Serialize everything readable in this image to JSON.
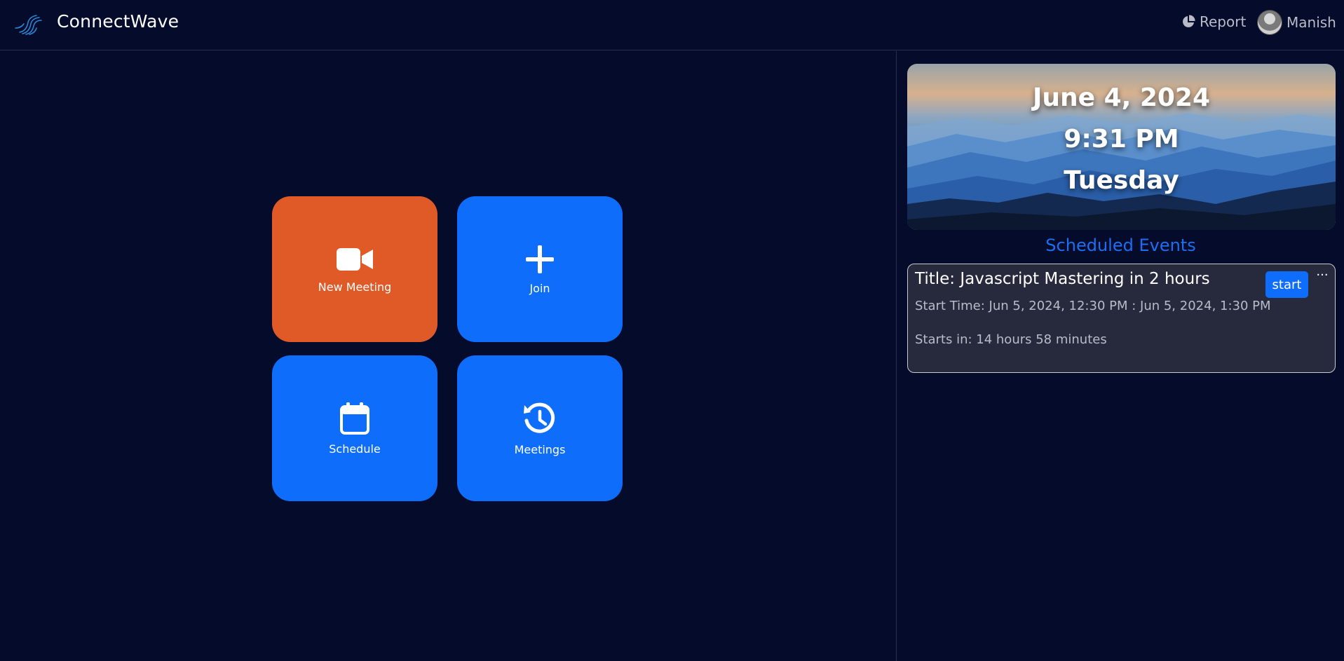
{
  "navbar": {
    "brand": "ConnectWave",
    "report_label": "Report",
    "user_name": "Manish"
  },
  "tiles": {
    "new_meeting": "New Meeting",
    "join": "Join",
    "schedule": "Schedule",
    "meetings": "Meetings"
  },
  "hero": {
    "date": "June 4, 2024",
    "time": "9:31 PM",
    "day": "Tuesday"
  },
  "scheduled": {
    "heading": "Scheduled Events",
    "events": [
      {
        "title": "Title: Javascript Mastering in 2 hours",
        "start_time": "Start Time: Jun 5, 2024, 12:30 PM : Jun 5, 2024, 1:30 PM",
        "starts_in": "Starts in: 14 hours 58 minutes",
        "start_label": "start",
        "more_label": "···"
      }
    ]
  },
  "colors": {
    "background": "#050b2a",
    "accent_blue": "#0e6efb",
    "accent_orange": "#e05a28",
    "card_bg": "#262a3c"
  },
  "icons": {
    "logo": "connectwave-wave-logo",
    "report": "pie-chart-icon",
    "new_meeting": "video-camera-icon",
    "join": "plus-icon",
    "schedule": "calendar-icon",
    "meetings": "history-icon"
  }
}
